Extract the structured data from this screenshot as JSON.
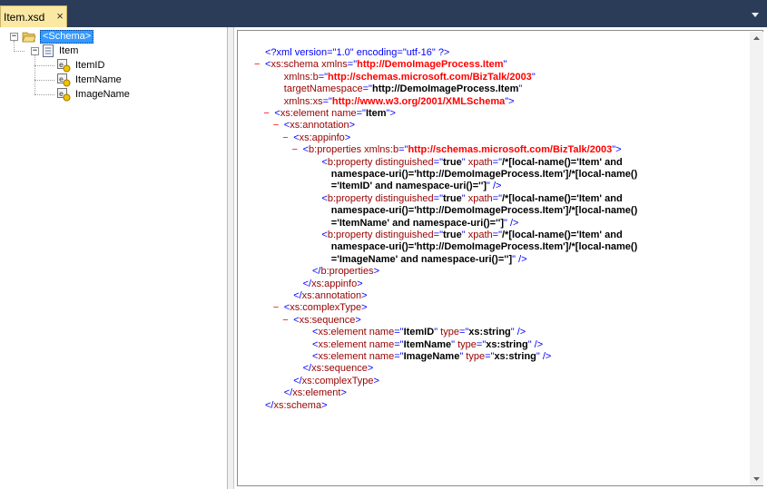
{
  "tab": {
    "title": "Item.xsd",
    "close": "×"
  },
  "tree": {
    "root": "<Schema>",
    "record": "Item",
    "fields": [
      "ItemID",
      "ItemName",
      "ImageName"
    ]
  },
  "xml_lines": [
    {
      "indent": 0,
      "minus": false,
      "parts": [
        [
          "pi",
          "<?xml version=\"1.0\" encoding=\"utf-16\" ?>"
        ]
      ]
    },
    {
      "indent": 0,
      "minus": true,
      "parts": [
        [
          "punct",
          "<"
        ],
        [
          "tag",
          "xs:schema"
        ],
        [
          "attr",
          " xmlns"
        ],
        [
          "punct",
          "=\""
        ],
        [
          "nsval",
          "http://DemoImageProcess.Item"
        ],
        [
          "punct",
          "\""
        ]
      ]
    },
    {
      "indent": 2,
      "minus": false,
      "parts": [
        [
          "attr",
          "xmlns:b"
        ],
        [
          "punct",
          "=\""
        ],
        [
          "nsval",
          "http://schemas.microsoft.com/BizTalk/2003"
        ],
        [
          "punct",
          "\""
        ]
      ]
    },
    {
      "indent": 2,
      "minus": false,
      "parts": [
        [
          "attr",
          "targetNamespace"
        ],
        [
          "punct",
          "=\""
        ],
        [
          "val",
          "http://DemoImageProcess.Item"
        ],
        [
          "punct",
          "\""
        ]
      ]
    },
    {
      "indent": 2,
      "minus": false,
      "parts": [
        [
          "attr",
          "xmlns:xs"
        ],
        [
          "punct",
          "=\""
        ],
        [
          "nsval",
          "http://www.w3.org/2001/XMLSchema"
        ],
        [
          "punct",
          "\">"
        ]
      ]
    },
    {
      "indent": 1,
      "minus": true,
      "parts": [
        [
          "punct",
          "<"
        ],
        [
          "tag",
          "xs:element"
        ],
        [
          "attr",
          " name"
        ],
        [
          "punct",
          "=\""
        ],
        [
          "val",
          "Item"
        ],
        [
          "punct",
          "\">"
        ]
      ]
    },
    {
      "indent": 2,
      "minus": true,
      "parts": [
        [
          "punct",
          "<"
        ],
        [
          "tag",
          "xs:annotation"
        ],
        [
          "punct",
          ">"
        ]
      ]
    },
    {
      "indent": 3,
      "minus": true,
      "parts": [
        [
          "punct",
          "<"
        ],
        [
          "tag",
          "xs:appinfo"
        ],
        [
          "punct",
          ">"
        ]
      ]
    },
    {
      "indent": 4,
      "minus": true,
      "parts": [
        [
          "punct",
          "<"
        ],
        [
          "tag",
          "b:properties"
        ],
        [
          "attr",
          " xmlns:b"
        ],
        [
          "punct",
          "=\""
        ],
        [
          "nsval",
          "http://schemas.microsoft.com/BizTalk/2003"
        ],
        [
          "punct",
          "\">"
        ]
      ]
    },
    {
      "indent": 6,
      "minus": false,
      "parts": [
        [
          "punct",
          "<"
        ],
        [
          "tag",
          "b:property"
        ],
        [
          "attr",
          " distinguished"
        ],
        [
          "punct",
          "=\""
        ],
        [
          "val",
          "true"
        ],
        [
          "punct",
          "\""
        ],
        [
          "attr",
          " xpath"
        ],
        [
          "punct",
          "=\""
        ],
        [
          "val",
          "/*[local-name()='Item' and"
        ]
      ]
    },
    {
      "indent": 7,
      "minus": false,
      "parts": [
        [
          "val",
          "namespace-uri()='http://DemoImageProcess.Item']/*[local-name()"
        ]
      ]
    },
    {
      "indent": 7,
      "minus": false,
      "parts": [
        [
          "val",
          "='ItemID' and namespace-uri()='']"
        ],
        [
          "punct",
          "\" />"
        ]
      ]
    },
    {
      "indent": 6,
      "minus": false,
      "parts": [
        [
          "punct",
          "<"
        ],
        [
          "tag",
          "b:property"
        ],
        [
          "attr",
          " distinguished"
        ],
        [
          "punct",
          "=\""
        ],
        [
          "val",
          "true"
        ],
        [
          "punct",
          "\""
        ],
        [
          "attr",
          " xpath"
        ],
        [
          "punct",
          "=\""
        ],
        [
          "val",
          "/*[local-name()='Item' and"
        ]
      ]
    },
    {
      "indent": 7,
      "minus": false,
      "parts": [
        [
          "val",
          "namespace-uri()='http://DemoImageProcess.Item']/*[local-name()"
        ]
      ]
    },
    {
      "indent": 7,
      "minus": false,
      "parts": [
        [
          "val",
          "='ItemName' and namespace-uri()='']"
        ],
        [
          "punct",
          "\" />"
        ]
      ]
    },
    {
      "indent": 6,
      "minus": false,
      "parts": [
        [
          "punct",
          "<"
        ],
        [
          "tag",
          "b:property"
        ],
        [
          "attr",
          " distinguished"
        ],
        [
          "punct",
          "=\""
        ],
        [
          "val",
          "true"
        ],
        [
          "punct",
          "\""
        ],
        [
          "attr",
          " xpath"
        ],
        [
          "punct",
          "=\""
        ],
        [
          "val",
          "/*[local-name()='Item' and"
        ]
      ]
    },
    {
      "indent": 7,
      "minus": false,
      "parts": [
        [
          "val",
          "namespace-uri()='http://DemoImageProcess.Item']/*[local-name()"
        ]
      ]
    },
    {
      "indent": 7,
      "minus": false,
      "parts": [
        [
          "val",
          "='ImageName' and namespace-uri()='']"
        ],
        [
          "punct",
          "\" />"
        ]
      ]
    },
    {
      "indent": 5,
      "minus": false,
      "parts": [
        [
          "punct",
          "</"
        ],
        [
          "tag",
          "b:properties"
        ],
        [
          "punct",
          ">"
        ]
      ]
    },
    {
      "indent": 4,
      "minus": false,
      "parts": [
        [
          "punct",
          "</"
        ],
        [
          "tag",
          "xs:appinfo"
        ],
        [
          "punct",
          ">"
        ]
      ]
    },
    {
      "indent": 3,
      "minus": false,
      "parts": [
        [
          "punct",
          "</"
        ],
        [
          "tag",
          "xs:annotation"
        ],
        [
          "punct",
          ">"
        ]
      ]
    },
    {
      "indent": 2,
      "minus": true,
      "parts": [
        [
          "punct",
          "<"
        ],
        [
          "tag",
          "xs:complexType"
        ],
        [
          "punct",
          ">"
        ]
      ]
    },
    {
      "indent": 3,
      "minus": true,
      "parts": [
        [
          "punct",
          "<"
        ],
        [
          "tag",
          "xs:sequence"
        ],
        [
          "punct",
          ">"
        ]
      ]
    },
    {
      "indent": 5,
      "minus": false,
      "parts": [
        [
          "punct",
          "<"
        ],
        [
          "tag",
          "xs:element"
        ],
        [
          "attr",
          " name"
        ],
        [
          "punct",
          "=\""
        ],
        [
          "val",
          "ItemID"
        ],
        [
          "punct",
          "\""
        ],
        [
          "attr",
          " type"
        ],
        [
          "punct",
          "=\""
        ],
        [
          "val",
          "xs:string"
        ],
        [
          "punct",
          "\" />"
        ]
      ]
    },
    {
      "indent": 5,
      "minus": false,
      "parts": [
        [
          "punct",
          "<"
        ],
        [
          "tag",
          "xs:element"
        ],
        [
          "attr",
          " name"
        ],
        [
          "punct",
          "=\""
        ],
        [
          "val",
          "ItemName"
        ],
        [
          "punct",
          "\""
        ],
        [
          "attr",
          " type"
        ],
        [
          "punct",
          "=\""
        ],
        [
          "val",
          "xs:string"
        ],
        [
          "punct",
          "\" />"
        ]
      ]
    },
    {
      "indent": 5,
      "minus": false,
      "parts": [
        [
          "punct",
          "<"
        ],
        [
          "tag",
          "xs:element"
        ],
        [
          "attr",
          " name"
        ],
        [
          "punct",
          "=\""
        ],
        [
          "val",
          "ImageName"
        ],
        [
          "punct",
          "\""
        ],
        [
          "attr",
          " type"
        ],
        [
          "punct",
          "=\""
        ],
        [
          "val",
          "xs:string"
        ],
        [
          "punct",
          "\" />"
        ]
      ]
    },
    {
      "indent": 4,
      "minus": false,
      "parts": [
        [
          "punct",
          "</"
        ],
        [
          "tag",
          "xs:sequence"
        ],
        [
          "punct",
          ">"
        ]
      ]
    },
    {
      "indent": 3,
      "minus": false,
      "parts": [
        [
          "punct",
          "</"
        ],
        [
          "tag",
          "xs:complexType"
        ],
        [
          "punct",
          ">"
        ]
      ]
    },
    {
      "indent": 2,
      "minus": false,
      "parts": [
        [
          "punct",
          "</"
        ],
        [
          "tag",
          "xs:element"
        ],
        [
          "punct",
          ">"
        ]
      ]
    },
    {
      "indent": 0,
      "minus": false,
      "parts": [
        [
          "punct",
          "</"
        ],
        [
          "tag",
          "xs:schema"
        ],
        [
          "punct",
          ">"
        ]
      ]
    }
  ],
  "colors": {
    "tab_bg": "#fbe9a3",
    "frame_bg": "#2b3c59",
    "selection": "#3399ff",
    "xml_tag": "#990000",
    "xml_punct": "#0000ff",
    "xml_ns_value": "#ff0000"
  }
}
